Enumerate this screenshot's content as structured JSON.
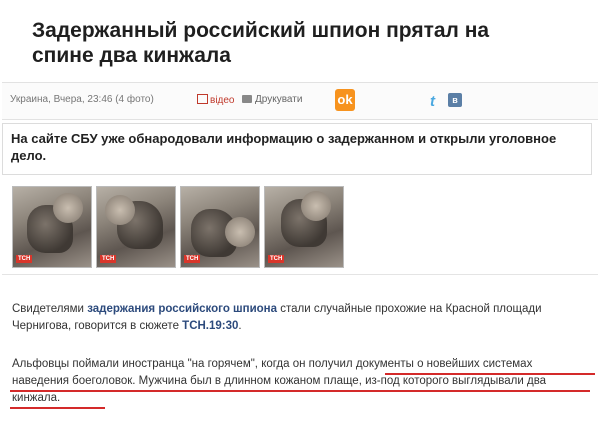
{
  "article": {
    "headline": "Задержанный российский шпион прятал на спине два кинжала",
    "meta": "Украина, Вчера, 23:46 (4 фото)",
    "video_label": "відео",
    "print_label": "Друкувати",
    "share": {
      "ok_icon": "odnoklassniki-icon",
      "twitter_icon": "twitter-icon",
      "vk_icon": "vk-icon",
      "ok_glyph": "ok",
      "twitter_glyph": "t",
      "vk_glyph": "в"
    },
    "lead": "На сайте СБУ уже обнародовали информацию о задержанном и открыли уголовное дело.",
    "photos": [
      {
        "badge": "ТСН"
      },
      {
        "badge": "ТСН"
      },
      {
        "badge": "ТСН"
      },
      {
        "badge": "ТСН"
      }
    ],
    "paragraph1": {
      "part1": "Свидетелями ",
      "link": "задержания российского шпиона",
      "part2": " стали случайные прохожие на Красной площади Чернигова, говорится в сюжете ",
      "source": "ТСН.19:30",
      "part3": "."
    },
    "paragraph2": "Альфовцы поймали иностранца \"на горячем\", когда он получил документы о новейших системах наведения боеголовок. Мужчина был в длинном кожаном плаще, из-под которого выглядывали два кинжала."
  },
  "colors": {
    "accent_link": "#2c4a7c",
    "underline": "#d42a2a",
    "ok_orange": "#f7931e"
  }
}
